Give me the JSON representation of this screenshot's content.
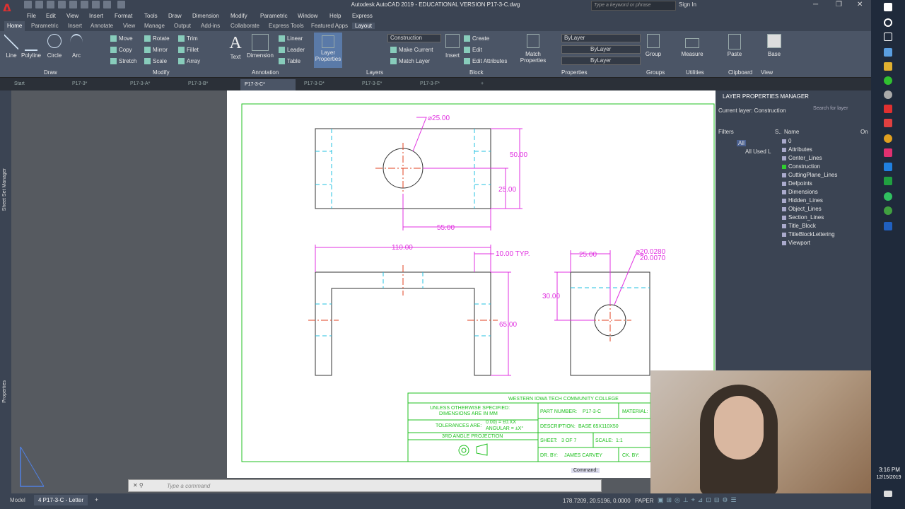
{
  "window": {
    "title": "Autodesk AutoCAD 2019 - EDUCATIONAL VERSION    P17-3-C.dwg",
    "search_placeholder": "Type a keyword or phrase",
    "signin": "Sign In"
  },
  "menu": [
    "File",
    "Edit",
    "View",
    "Insert",
    "Format",
    "Tools",
    "Draw",
    "Dimension",
    "Modify",
    "Parametric",
    "Window",
    "Help",
    "Express"
  ],
  "ribbon_tabs": [
    "Home",
    "Parametric",
    "Insert",
    "Annotate",
    "View",
    "Manage",
    "Output",
    "Add-ins",
    "Collaborate",
    "Express Tools",
    "Featured Apps",
    "Layout"
  ],
  "ribbon": {
    "draw": {
      "line": "Line",
      "polyline": "Polyline",
      "circle": "Circle",
      "arc": "Arc",
      "panel": "Draw"
    },
    "modify": {
      "move": "Move",
      "rotate": "Rotate",
      "trim": "Trim",
      "copy": "Copy",
      "mirror": "Mirror",
      "fillet": "Fillet",
      "stretch": "Stretch",
      "scale": "Scale",
      "array": "Array",
      "panel": "Modify"
    },
    "annotation": {
      "text": "Text",
      "dimension": "Dimension",
      "linear": "Linear",
      "leader": "Leader",
      "table": "Table",
      "panel": "Annotation"
    },
    "layers": {
      "layer_properties": "Layer Properties",
      "current": "Construction",
      "make_current": "Make Current",
      "match_layer": "Match Layer",
      "panel": "Layers"
    },
    "block": {
      "insert": "Insert",
      "create": "Create",
      "edit": "Edit",
      "edit_attributes": "Edit Attributes",
      "panel": "Block"
    },
    "properties": {
      "match": "Match Properties",
      "bylayer1": "ByLayer",
      "bylayer2": "ByLayer",
      "bylayer3": "ByLayer",
      "panel": "Properties"
    },
    "groups": {
      "group": "Group",
      "panel": "Groups"
    },
    "utilities": {
      "measure": "Measure",
      "panel": "Utilities"
    },
    "clipboard": {
      "paste": "Paste",
      "panel": "Clipboard"
    },
    "view": {
      "base": "Base",
      "panel": "View"
    }
  },
  "doc_tabs": [
    "Start",
    "P17-3*",
    "P17-3-A*",
    "P17-3-B*",
    "P17-3-C*",
    "P17-3-D*",
    "P17-3-E*",
    "P17-3-F*"
  ],
  "side_labels": {
    "sheet_set": "Sheet Set Manager",
    "properties": "Properties"
  },
  "drawing": {
    "dims": {
      "dia25": "⌀25.00",
      "d50": "50.00",
      "d25": "25.00",
      "d55": "55.00",
      "d110": "110.00",
      "d10typ": "10.00  TYP.",
      "d65": "65.00",
      "d25b": "25.00",
      "dia_tol1": "⌀20.0280",
      "dia_tol2": "20.0070",
      "d30": "30.00"
    },
    "title_block": {
      "college": "WESTERN IOWA TECH COMMUNITY COLLEGE",
      "note1": "UNLESS OTHERWISE SPECIFIED:",
      "note2": "DIMENSIONS ARE IN MM",
      "tol_label": "TOLERANCES ARE:",
      "tol1": "0.00) = ±0.XX",
      "tol2": "ANGULAR = ±X°",
      "projection": "3RD ANGLE PROJECTION",
      "part_label": "PART NUMBER:",
      "part_value": "P17-3-C",
      "material_label": "MATERIAL:",
      "desc_label": "DESCRIPTION:",
      "desc_value": "BASE 65X110X50",
      "sheet_label": "SHEET:",
      "sheet_value": "3 OF 7",
      "scale_label": "SCALE:",
      "scale_value": "1:1",
      "dr_label": "DR. BY:",
      "dr_value": "JAMES CARVEY",
      "ck_label": "CK. BY:"
    }
  },
  "layer_manager": {
    "title": "LAYER PROPERTIES MANAGER",
    "current": "Current layer: Construction",
    "search": "Search for layer",
    "filters": "Filters",
    "all": "All",
    "all_used": "All Used L",
    "col_s": "S..",
    "col_name": "Name",
    "col_on": "On",
    "layers": [
      "0",
      "Attributes",
      "Center_Lines",
      "Construction",
      "CuttingPlane_Lines",
      "Defpoints",
      "Dimensions",
      "Hidden_Lines",
      "Object_Lines",
      "Section_Lines",
      "Title_Block",
      "TitleBlockLettering",
      "Viewport"
    ]
  },
  "command": {
    "tooltip": "Command:",
    "placeholder": "Type a command"
  },
  "status": {
    "model": "Model",
    "layout": "4 P17-3-C - Letter",
    "coords": "178.7209, 20.5196, 0.0000",
    "paper": "PAPER"
  },
  "clock": {
    "time": "3:16 PM",
    "date": "12/15/2019"
  },
  "colors": {
    "dim": "#e030e0",
    "green": "#20c020",
    "cyan": "#20c0e0",
    "red": "#e04020"
  }
}
